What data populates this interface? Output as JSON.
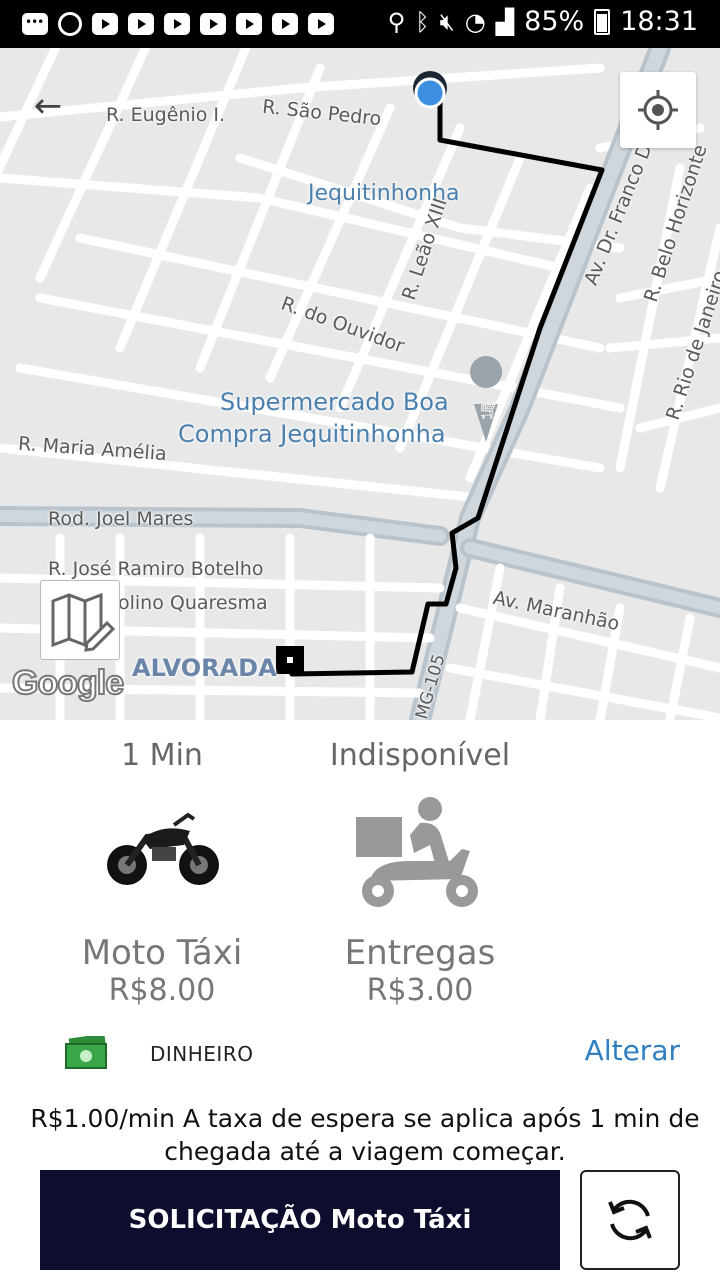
{
  "status_bar": {
    "battery": "85%",
    "time": "18:31"
  },
  "map": {
    "streets": [
      "R. Eugênio I.",
      "R. São Pedro",
      "Jequitinhonha",
      "R. Leão XIII",
      "Av. Dr. Franco Duarte",
      "R. Belo Horizonte",
      "R. Rio de Janeiro",
      "R. do Ouvidor",
      "R. Maria Amélia",
      "Rod. Joel Mares",
      "R. José Ramiro Botelho",
      "olino Quaresma",
      "Av. Maranhão",
      "MG-105"
    ],
    "poi_line1": "Supermercado Boa",
    "poi_line2": "Compra Jequitinhonha",
    "district": "ALVORADA",
    "google": "Google"
  },
  "options": [
    {
      "eta": "1 Min",
      "name": "Moto Táxi",
      "price": "R$8.00",
      "icon": "motorcycle-icon"
    },
    {
      "eta": "Indisponível",
      "name": "Entregas",
      "price": "R$3.00",
      "icon": "delivery-scooter-icon"
    }
  ],
  "payment": {
    "method": "DINHEIRO",
    "change_label": "Alterar",
    "icon": "cash-icon"
  },
  "fee_text": "R$1.00/min A taxa de espera se aplica após 1 min de chegada até a viagem começar.",
  "request_button": "SOLICITAÇÃO Moto Táxi",
  "colors": {
    "accent": "#2f7fc1",
    "button_bg": "#0d0d2e",
    "route": "#000000",
    "poi": "#4a7fae"
  }
}
